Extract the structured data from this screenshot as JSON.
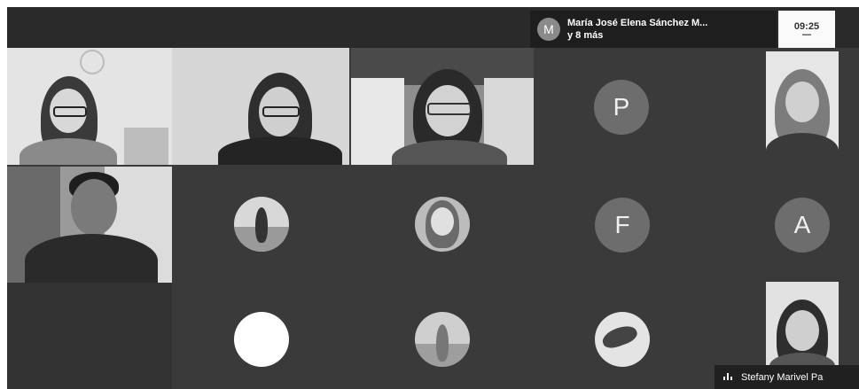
{
  "notification": {
    "avatar_letter": "M",
    "line1": "María José Elena Sánchez M...",
    "line2": "y 8 más"
  },
  "clock": {
    "time": "09:25"
  },
  "participants": {
    "p_letter": "P",
    "f_letter": "F",
    "a_letter": "A"
  },
  "speaker": {
    "name": "Stefany Marivel Pa"
  },
  "colors": {
    "background": "#3a3a3a",
    "letter_avatar": "#6d6d6d",
    "white_avatar": "#ffffff"
  }
}
